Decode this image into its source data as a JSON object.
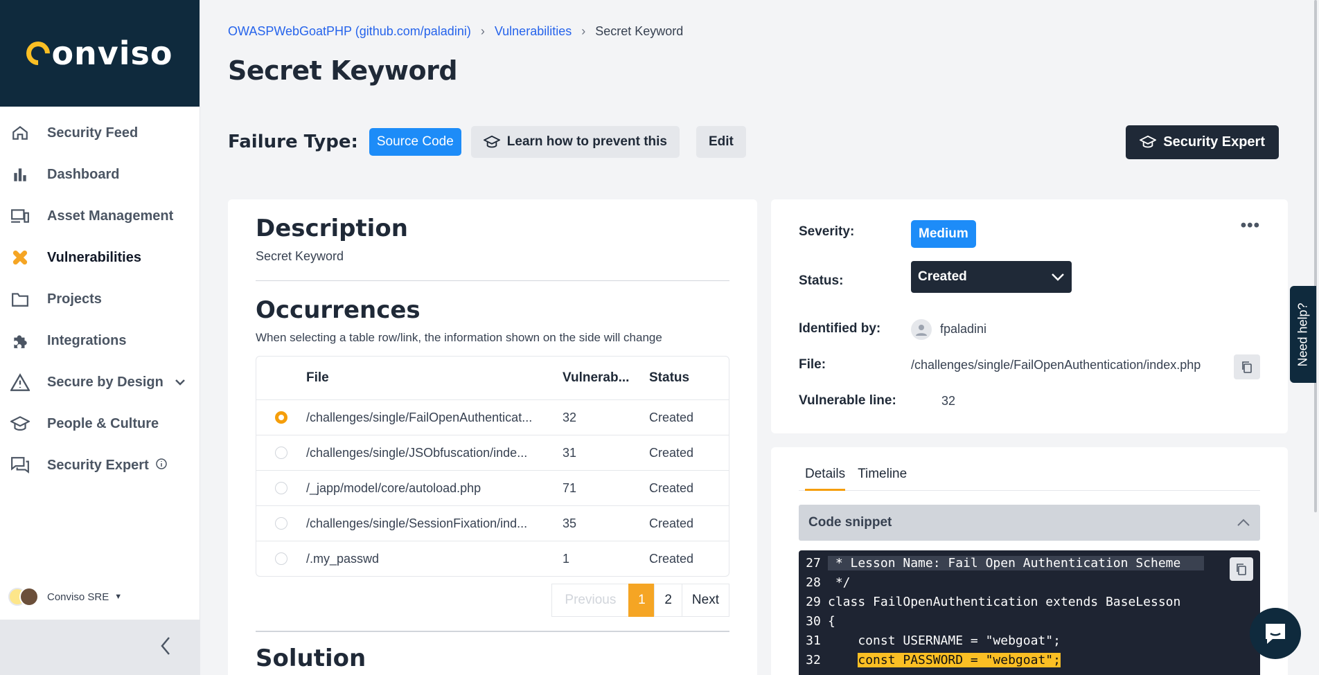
{
  "brand": {
    "name": "onviso",
    "accent": "#fbbf24",
    "dark": "#0f2a3d",
    "blue": "#1d8cf8"
  },
  "sidebar": {
    "items": [
      {
        "label": "Security Feed",
        "icon": "home-icon"
      },
      {
        "label": "Dashboard",
        "icon": "bar-chart-icon"
      },
      {
        "label": "Asset Management",
        "icon": "devices-icon"
      },
      {
        "label": "Vulnerabilities",
        "icon": "bandage-icon",
        "active": true
      },
      {
        "label": "Projects",
        "icon": "folder-icon"
      },
      {
        "label": "Integrations",
        "icon": "puzzle-icon"
      },
      {
        "label": "Secure by Design",
        "icon": "warning-icon"
      },
      {
        "label": "People & Culture",
        "icon": "graduation-cap-icon"
      },
      {
        "label": "Security Expert",
        "icon": "chat-icon"
      }
    ],
    "user": {
      "name": "Conviso SRE"
    }
  },
  "breadcrumb": {
    "project": "OWASPWebGoatPHP (github.com/paladini)",
    "section": "Vulnerabilities",
    "current": "Secret Keyword"
  },
  "page_title": "Secret Keyword",
  "failure": {
    "label": "Failure Type:",
    "type": "Source Code",
    "learn_label": "Learn how to prevent this",
    "edit_label": "Edit",
    "expert_label": "Security Expert"
  },
  "description": {
    "title": "Description",
    "text": "Secret Keyword"
  },
  "occurrences": {
    "title": "Occurrences",
    "subtitle": "When selecting a table row/link, the information shown on the side will change",
    "columns": [
      "File",
      "Vulnerab...",
      "Status"
    ],
    "rows": [
      {
        "file": "/challenges/single/FailOpenAuthenticat...",
        "line": "32",
        "status": "Created",
        "selected": true
      },
      {
        "file": "/challenges/single/JSObfuscation/inde...",
        "line": "31",
        "status": "Created"
      },
      {
        "file": "/_japp/model/core/autoload.php",
        "line": "71",
        "status": "Created"
      },
      {
        "file": "/challenges/single/SessionFixation/ind...",
        "line": "35",
        "status": "Created"
      },
      {
        "file": "/.my_passwd",
        "line": "1",
        "status": "Created"
      }
    ],
    "pager": {
      "previous": "Previous",
      "page1": "1",
      "page2": "2",
      "next": "Next"
    }
  },
  "solution_title": "Solution",
  "details": {
    "severity_label": "Severity:",
    "severity": "Medium",
    "status_label": "Status:",
    "status": "Created",
    "identified_label": "Identified by:",
    "identified": "fpaladini",
    "file_label": "File:",
    "file": "/challenges/single/FailOpenAuthentication/index.php",
    "line_label": "Vulnerable line:",
    "line": "32"
  },
  "tabs": {
    "details": "Details",
    "timeline": "Timeline"
  },
  "snippet": {
    "title": "Code snippet",
    "lines": [
      {
        "n": "27",
        "t": " * Lesson Name: Fail Open Authentication Scheme"
      },
      {
        "n": "28",
        "t": " */"
      },
      {
        "n": "29",
        "t": "class FailOpenAuthentication extends BaseLesson"
      },
      {
        "n": "30",
        "t": "{"
      },
      {
        "n": "31",
        "t": "    const USERNAME = \"webgoat\";"
      },
      {
        "n": "32",
        "t_pre": "    ",
        "t_hl": "const PASSWORD = \"webgoat\";"
      }
    ]
  },
  "help": {
    "label": "Need help?"
  }
}
